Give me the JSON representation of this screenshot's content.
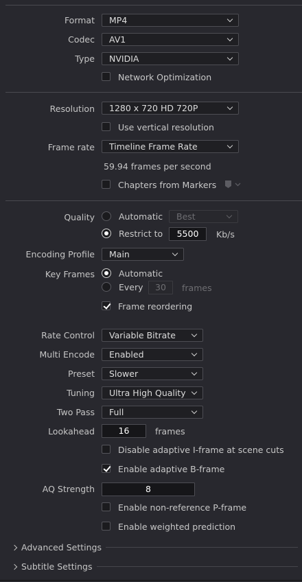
{
  "format": {
    "label": "Format",
    "value": "MP4"
  },
  "codec": {
    "label": "Codec",
    "value": "AV1"
  },
  "type": {
    "label": "Type",
    "value": "NVIDIA"
  },
  "network_optimization": {
    "label": "Network Optimization",
    "checked": false
  },
  "resolution": {
    "label": "Resolution",
    "value": "1280 x 720 HD 720P"
  },
  "use_vertical_resolution": {
    "label": "Use vertical resolution",
    "checked": false
  },
  "frame_rate": {
    "label": "Frame rate",
    "value": "Timeline Frame Rate",
    "info": "59.94 frames per second"
  },
  "chapters_from_markers": {
    "label": "Chapters from Markers",
    "checked": false
  },
  "quality": {
    "label": "Quality",
    "automatic_label": "Automatic",
    "automatic_value": "Best",
    "restrict_label": "Restrict to",
    "restrict_value": "5500",
    "unit": "Kb/s",
    "selected": "restrict"
  },
  "encoding_profile": {
    "label": "Encoding Profile",
    "value": "Main"
  },
  "key_frames": {
    "label": "Key Frames",
    "automatic_label": "Automatic",
    "every_label": "Every",
    "every_value": "30",
    "unit": "frames",
    "selected": "automatic"
  },
  "frame_reordering": {
    "label": "Frame reordering",
    "checked": true
  },
  "rate_control": {
    "label": "Rate Control",
    "value": "Variable Bitrate"
  },
  "multi_encode": {
    "label": "Multi Encode",
    "value": "Enabled"
  },
  "preset": {
    "label": "Preset",
    "value": "Slower"
  },
  "tuning": {
    "label": "Tuning",
    "value": "Ultra High Quality"
  },
  "two_pass": {
    "label": "Two Pass",
    "value": "Full"
  },
  "lookahead": {
    "label": "Lookahead",
    "value": "16",
    "unit": "frames"
  },
  "disable_adaptive_i": {
    "label": "Disable adaptive I-frame at scene cuts",
    "checked": false
  },
  "enable_adaptive_b": {
    "label": "Enable adaptive B-frame",
    "checked": true
  },
  "aq_strength": {
    "label": "AQ Strength",
    "value": "8"
  },
  "non_reference_p": {
    "label": "Enable non-reference P-frame",
    "checked": false
  },
  "weighted_prediction": {
    "label": "Enable weighted prediction",
    "checked": false
  },
  "advanced_settings": {
    "label": "Advanced Settings"
  },
  "subtitle_settings": {
    "label": "Subtitle Settings"
  },
  "colors": {
    "background": "#28282e",
    "field": "#1f1f23",
    "text": "#c9c9c9",
    "check": "#ffffff"
  }
}
